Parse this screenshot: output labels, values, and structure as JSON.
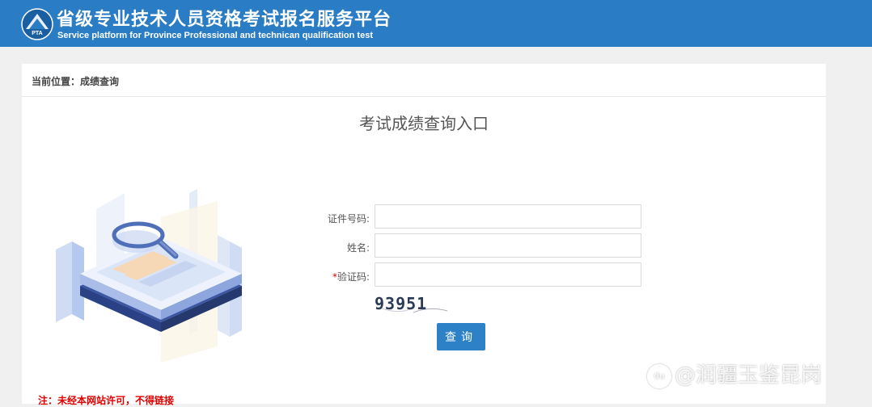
{
  "header": {
    "logo_text": "PTA",
    "title_cn": "省级专业技术人员资格考试报名服务平台",
    "title_en": "Service platform for Province Professional and technican qualification test"
  },
  "breadcrumb": "当前位置：成绩查询",
  "page_title": "考试成绩查询入口",
  "form": {
    "id_label": "证件号码:",
    "id_value": "",
    "name_label": "姓名:",
    "name_value": "",
    "captcha_label_required_mark": "*",
    "captcha_label": "验证码:",
    "captcha_value": "",
    "captcha_image_text": "93951",
    "submit_label": "查询"
  },
  "notice": "注：未经本网站许可，不得链接",
  "watermark": {
    "badge": "du",
    "text": "@润疆玉鉴昆岗"
  },
  "colors": {
    "header_bg": "#2a7dc4",
    "button_bg": "#2c81c7",
    "notice": "#dd0000",
    "page_bg": "#f0f0f0"
  },
  "icons": [
    "pta-logo-icon",
    "magnifier-illustration"
  ]
}
